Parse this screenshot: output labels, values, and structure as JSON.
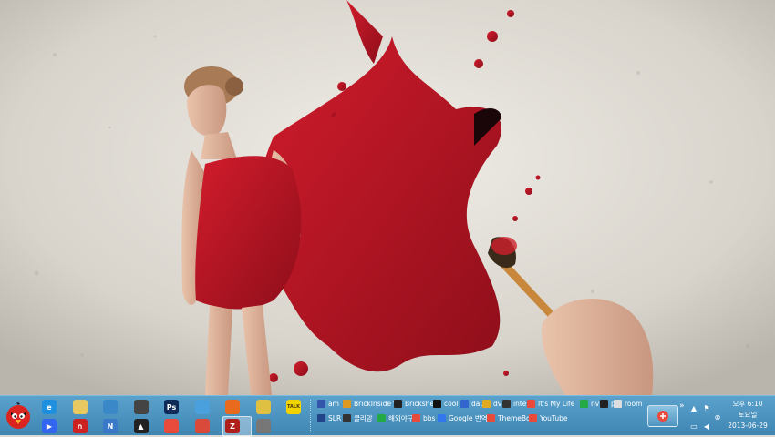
{
  "wallpaper": {
    "description_icon": "woman-red-dress-paint-splash"
  },
  "taskbar": {
    "start": {
      "icon": "angry-bird-icon"
    },
    "quick_launch": [
      {
        "name": "ie-icon",
        "glyph": "e",
        "color": "#1f8fe0"
      },
      {
        "name": "folder-icon",
        "glyph": "",
        "color": "#e8c860"
      },
      {
        "name": "app-icon-1",
        "glyph": "",
        "color": "#3a88c8"
      },
      {
        "name": "photo-app-icon",
        "glyph": "",
        "color": "#444444"
      },
      {
        "name": "photoshop-icon",
        "glyph": "Ps",
        "color": "#102a58"
      },
      {
        "name": "windows-app-icon",
        "glyph": "",
        "color": "#4aa0dd"
      },
      {
        "name": "firefox-icon",
        "glyph": "",
        "color": "#e86a1c"
      },
      {
        "name": "ftp-app-icon",
        "glyph": "",
        "color": "#e0c040"
      },
      {
        "name": "kakaotalk-icon",
        "glyph": "TALK",
        "color": "#f2d400"
      },
      {
        "name": "daum-player-icon",
        "glyph": "▶",
        "color": "#3366ee"
      },
      {
        "name": "horseshoe-app-icon",
        "glyph": "∩",
        "color": "#cc2222"
      },
      {
        "name": "nitro-app-icon",
        "glyph": "N",
        "color": "#3a78c8"
      },
      {
        "name": "triangle-app-icon",
        "glyph": "▲",
        "color": "#222222"
      },
      {
        "name": "chrome-icon",
        "glyph": "",
        "color": "#e84b3c"
      },
      {
        "name": "cleaner-app-icon",
        "glyph": "",
        "color": "#d94a3a"
      },
      {
        "name": "filezilla-icon",
        "glyph": "Z",
        "color": "#b0201a"
      },
      {
        "name": "usb-drive-icon",
        "glyph": "",
        "color": "#777777"
      }
    ],
    "links_row1": [
      {
        "label": "am",
        "color": "#3355aa"
      },
      {
        "label": "BrickInside™",
        "color": "#dd9922"
      },
      {
        "label": "Brickshelf",
        "color": "#222222"
      },
      {
        "label": "cool",
        "color": "#111111"
      },
      {
        "label": "dau",
        "color": "#3366cc"
      },
      {
        "label": "dv",
        "color": "#ddaa22"
      },
      {
        "label": "inte",
        "color": "#333333"
      },
      {
        "label": "It's My Life",
        "color": "#e84b3c"
      },
      {
        "label": "nv",
        "color": "#22aa44"
      },
      {
        "label": "pk",
        "color": "#222222"
      },
      {
        "label": "room",
        "color": "#dddddd"
      }
    ],
    "links_row2": [
      {
        "label": "SLR",
        "color": "#224488"
      },
      {
        "label": "클리앙",
        "color": "#333333"
      },
      {
        "label": "해외야구",
        "color": "#22aa44"
      },
      {
        "label": "bbs",
        "color": "#e84b3c"
      },
      {
        "label": "Google 번역",
        "color": "#3377ee"
      },
      {
        "label": "ThemeBox",
        "color": "#e84b3c"
      },
      {
        "label": "YouTube",
        "color": "#e84b3c"
      }
    ],
    "overflow_chevron": "»",
    "clock": {
      "time": "오후 6:10",
      "weekday": "토요일",
      "date": "2013-06-29"
    }
  }
}
